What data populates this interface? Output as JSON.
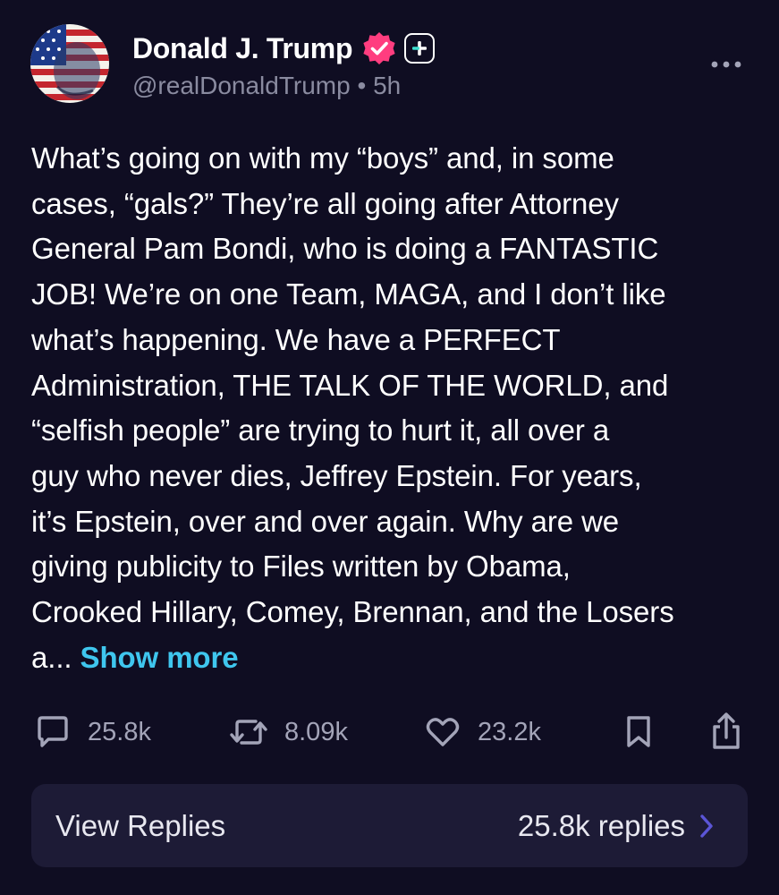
{
  "post": {
    "author_name": "Donald J. Trump",
    "handle": "@realDonaldTrump",
    "separator": "•",
    "time": "5h",
    "text": "What’s going on with my “boys” and, in some\ncases, “gals?” They’re all going after Attorney\nGeneral Pam Bondi, who is doing a FANTASTIC\nJOB! We’re on one Team, MAGA, and I don’t like\nwhat’s happening. We have a PERFECT\nAdministration, THE TALK OF THE WORLD, and\n“selfish people” are trying to hurt it, all over a\nguy who never dies, Jeffrey Epstein. For years,\nit’s Epstein, over and over again. Why are we\ngiving publicity to Files written by Obama,\nCrooked Hillary, Comey, Brennan, and the Losers\na... ",
    "show_more_label": "Show more"
  },
  "actions": {
    "replies_count": "25.8k",
    "reposts_count": "8.09k",
    "likes_count": "23.2k"
  },
  "replies_bar": {
    "label": "View Replies",
    "count_text": "25.8k replies"
  },
  "icons": {
    "avatar": "avatar-image",
    "verified": "verified-badge-icon",
    "plus": "plus-badge-icon",
    "more": "more-options-icon",
    "reply": "reply-bubble-icon",
    "repost": "repost-icon",
    "like": "heart-icon",
    "bookmark": "bookmark-icon",
    "share": "share-icon",
    "chevron": "chevron-right-icon"
  },
  "colors": {
    "background": "#0f0d22",
    "accent_link": "#3fc6ee",
    "verified": "#ff3d7f",
    "muted_text": "#8a8ba0",
    "replies_bar_bg": "#1d1b36",
    "chevron": "#5b55d6"
  }
}
